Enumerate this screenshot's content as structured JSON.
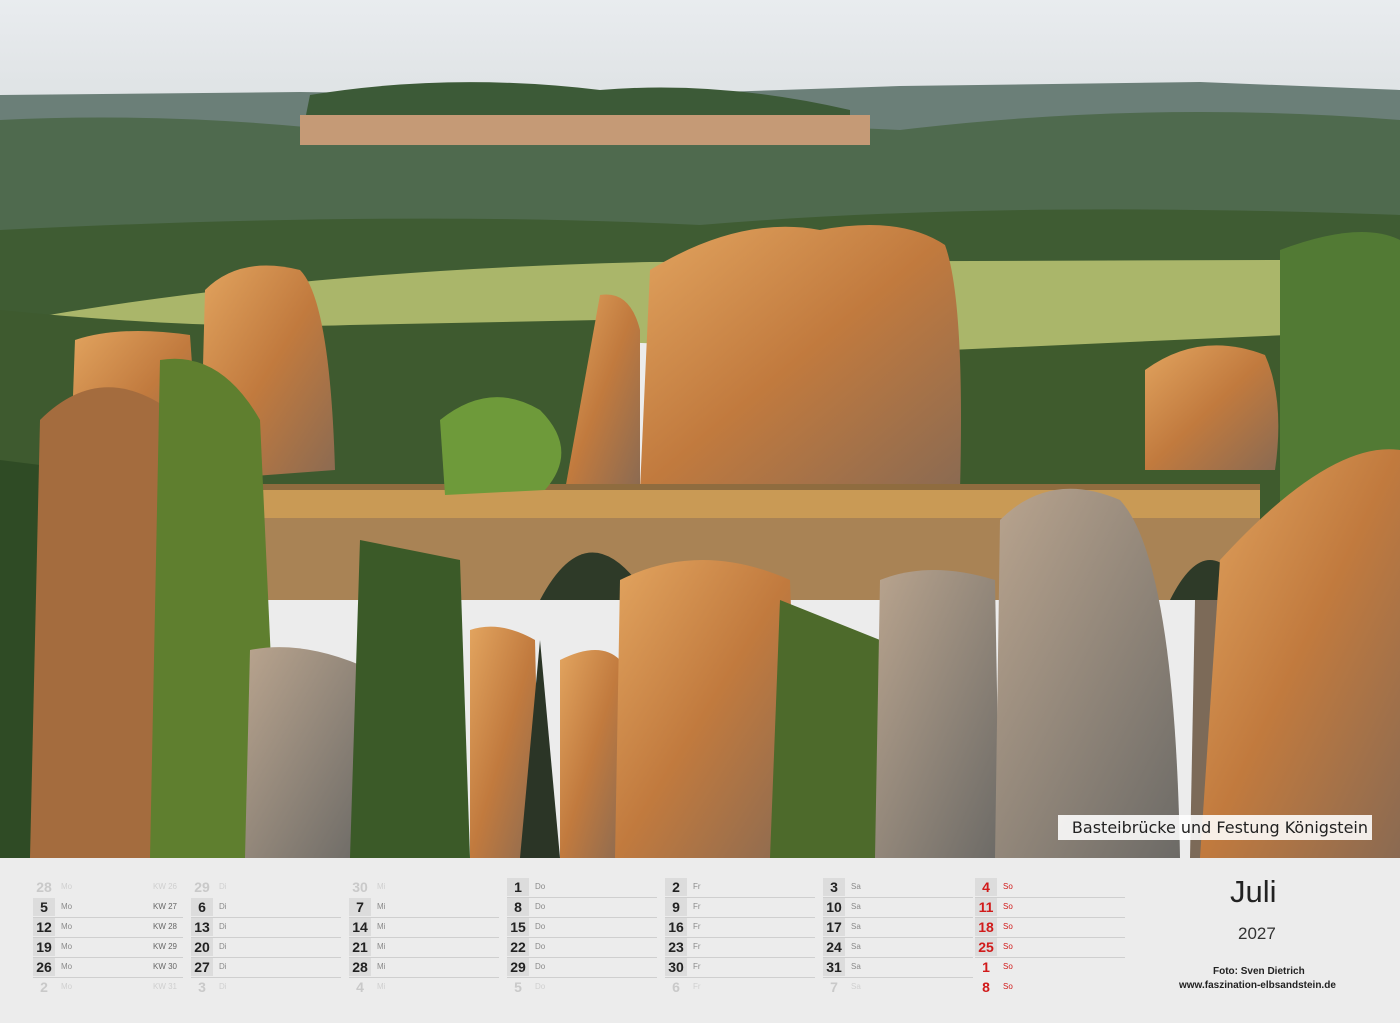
{
  "photo": {
    "caption": "Basteibrücke und Festung Königstein",
    "icon": "landscape-photo-rock-bridge"
  },
  "calendar": {
    "month": "Juli",
    "year": "2027",
    "credit_photographer": "Foto: Sven Dietrich",
    "credit_url": "www.faszination-elbsandstein.de",
    "colors": {
      "sunday": "#d11a1a",
      "day_box": "#dcdcdc",
      "ghost": "#c7c7c7"
    },
    "columns": [
      {
        "rows": [
          {
            "n": "28",
            "wd": "Mo",
            "kw": "KW 26",
            "ghost": true
          },
          {
            "n": "5",
            "wd": "Mo",
            "kw": "KW 27"
          },
          {
            "n": "12",
            "wd": "Mo",
            "kw": "KW 28"
          },
          {
            "n": "19",
            "wd": "Mo",
            "kw": "KW 29"
          },
          {
            "n": "26",
            "wd": "Mo",
            "kw": "KW 30"
          },
          {
            "n": "2",
            "wd": "Mo",
            "kw": "KW 31",
            "ghost": true
          }
        ]
      },
      {
        "rows": [
          {
            "n": "29",
            "wd": "Di",
            "ghost": true
          },
          {
            "n": "6",
            "wd": "Di"
          },
          {
            "n": "13",
            "wd": "Di"
          },
          {
            "n": "20",
            "wd": "Di"
          },
          {
            "n": "27",
            "wd": "Di"
          },
          {
            "n": "3",
            "wd": "Di",
            "ghost": true
          }
        ]
      },
      {
        "rows": [
          {
            "n": "30",
            "wd": "Mi",
            "ghost": true
          },
          {
            "n": "7",
            "wd": "Mi"
          },
          {
            "n": "14",
            "wd": "Mi"
          },
          {
            "n": "21",
            "wd": "Mi"
          },
          {
            "n": "28",
            "wd": "Mi"
          },
          {
            "n": "4",
            "wd": "Mi",
            "ghost": true
          }
        ]
      },
      {
        "rows": [
          {
            "n": "1",
            "wd": "Do"
          },
          {
            "n": "8",
            "wd": "Do"
          },
          {
            "n": "15",
            "wd": "Do"
          },
          {
            "n": "22",
            "wd": "Do"
          },
          {
            "n": "29",
            "wd": "Do"
          },
          {
            "n": "5",
            "wd": "Do",
            "ghost": true
          }
        ]
      },
      {
        "rows": [
          {
            "n": "2",
            "wd": "Fr"
          },
          {
            "n": "9",
            "wd": "Fr"
          },
          {
            "n": "16",
            "wd": "Fr"
          },
          {
            "n": "23",
            "wd": "Fr"
          },
          {
            "n": "30",
            "wd": "Fr"
          },
          {
            "n": "6",
            "wd": "Fr",
            "ghost": true
          }
        ]
      },
      {
        "rows": [
          {
            "n": "3",
            "wd": "Sa"
          },
          {
            "n": "10",
            "wd": "Sa"
          },
          {
            "n": "17",
            "wd": "Sa"
          },
          {
            "n": "24",
            "wd": "Sa"
          },
          {
            "n": "31",
            "wd": "Sa"
          },
          {
            "n": "7",
            "wd": "Sa",
            "ghost": true
          }
        ]
      },
      {
        "sunday": true,
        "rows": [
          {
            "n": "4",
            "wd": "So"
          },
          {
            "n": "11",
            "wd": "So"
          },
          {
            "n": "18",
            "wd": "So"
          },
          {
            "n": "25",
            "wd": "So"
          },
          {
            "n": "1",
            "wd": "So",
            "ghost": true
          },
          {
            "n": "8",
            "wd": "So",
            "ghost": true
          }
        ]
      }
    ]
  }
}
